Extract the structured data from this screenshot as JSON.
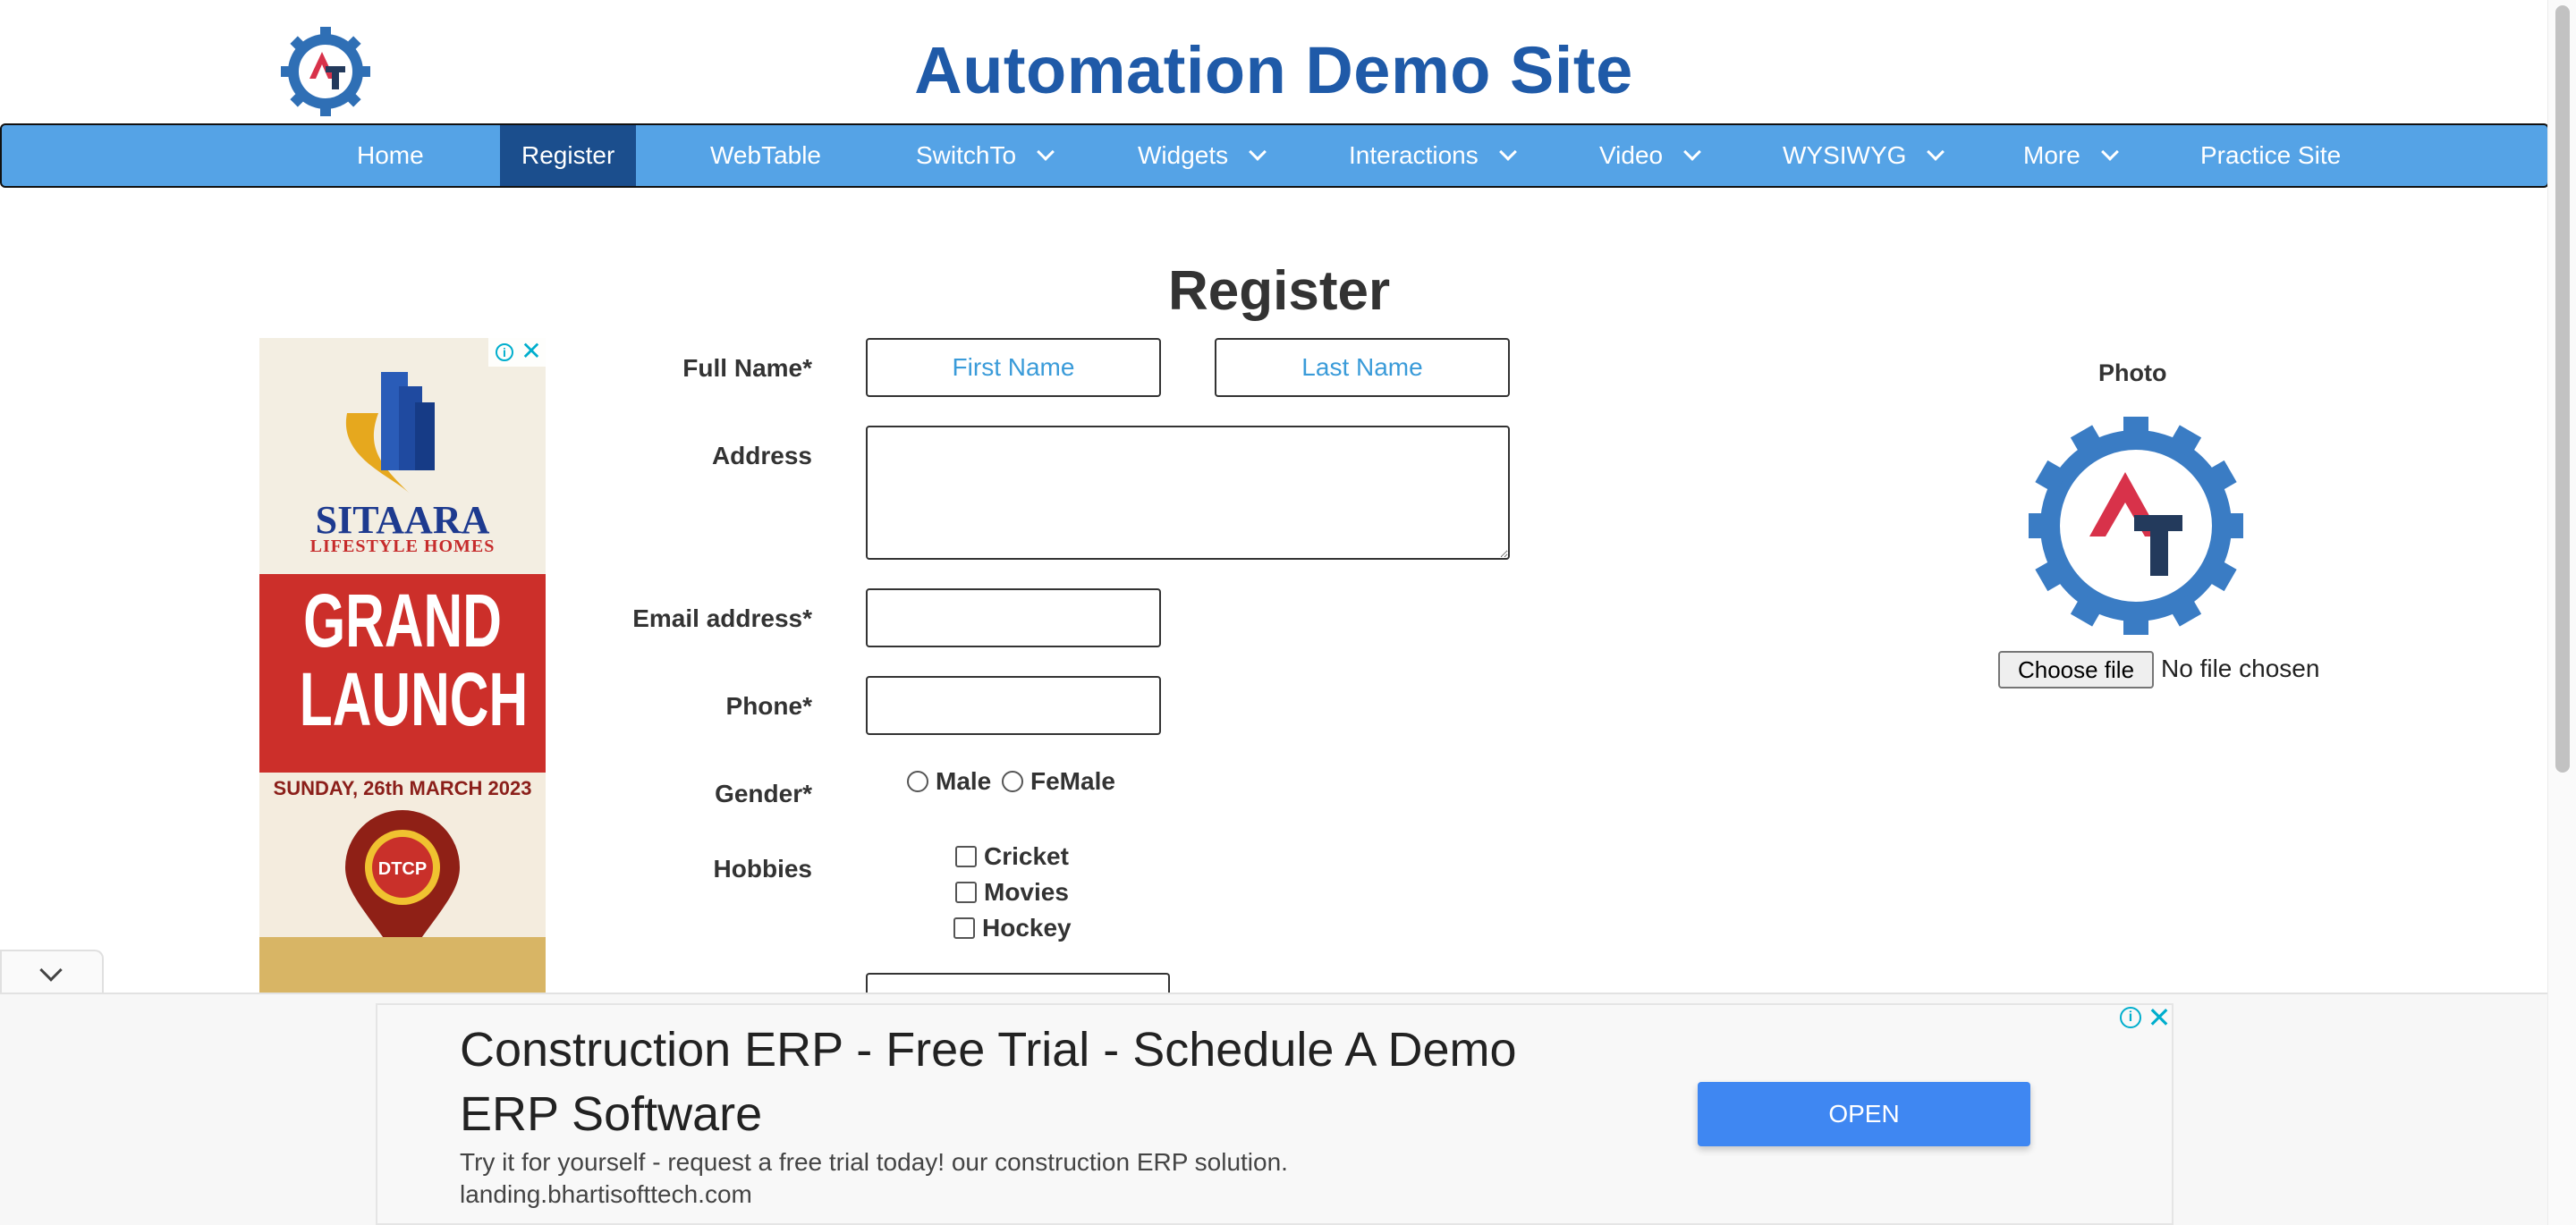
{
  "header": {
    "site_title": "Automation Demo Site"
  },
  "nav": {
    "items": [
      {
        "label": "Home",
        "has_dropdown": false,
        "active": false
      },
      {
        "label": "Register",
        "has_dropdown": false,
        "active": true
      },
      {
        "label": "WebTable",
        "has_dropdown": false,
        "active": false
      },
      {
        "label": "SwitchTo",
        "has_dropdown": true,
        "active": false
      },
      {
        "label": "Widgets",
        "has_dropdown": true,
        "active": false
      },
      {
        "label": "Interactions",
        "has_dropdown": true,
        "active": false
      },
      {
        "label": "Video",
        "has_dropdown": true,
        "active": false
      },
      {
        "label": "WYSIWYG",
        "has_dropdown": true,
        "active": false
      },
      {
        "label": "More",
        "has_dropdown": true,
        "active": false
      },
      {
        "label": "Practice Site",
        "has_dropdown": false,
        "active": false
      }
    ]
  },
  "form": {
    "heading": "Register",
    "full_name_label": "Full Name*",
    "first_name_placeholder": "First Name",
    "last_name_placeholder": "Last Name",
    "address_label": "Address",
    "email_label": "Email address*",
    "phone_label": "Phone*",
    "gender_label": "Gender*",
    "gender_options": [
      "Male",
      "FeMale"
    ],
    "hobbies_label": "Hobbies",
    "hobbies": [
      "Cricket",
      "Movies",
      "Hockey"
    ]
  },
  "photo": {
    "label": "Photo",
    "choose_file": "Choose file",
    "no_file": "No file chosen"
  },
  "side_ad": {
    "brand": "SITAARA",
    "brand_sub": "LIFESTYLE HOMES",
    "line1": "GRAND",
    "line2": "LAUNCH",
    "date": "SUNDAY, 26th MARCH 2023",
    "badge": "DTCP"
  },
  "bottom_ad": {
    "headline": "Construction ERP - Free Trial - Schedule A Demo ERP Software",
    "description": "Try it for yourself - request a free trial today! our construction ERP solution.",
    "url": "landing.bhartisofttech.com",
    "button": "OPEN"
  },
  "colors": {
    "title_blue": "#1f5aa8",
    "nav_bg": "#55a3e6",
    "nav_active": "#1b4e8d",
    "placeholder_blue": "#3a9bd9",
    "ad_button": "#3f87f2"
  }
}
